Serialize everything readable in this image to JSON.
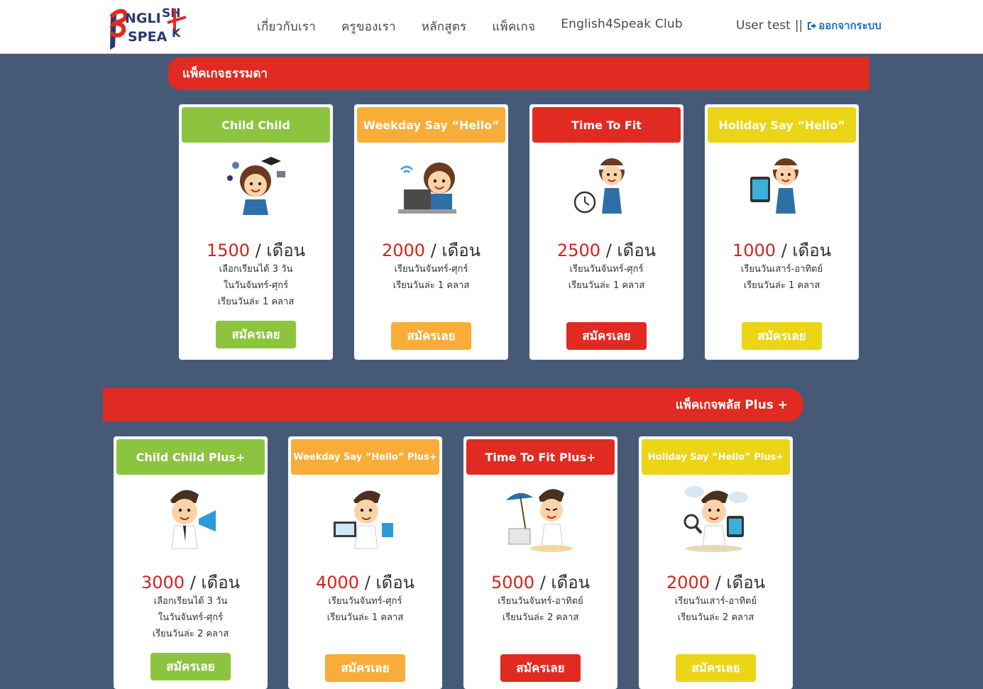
{
  "header": {
    "logo_text": "ENGLISH SPEAK",
    "nav": [
      "เกี่ยวกับเรา",
      "ครูของเรา",
      "หลักสูตร",
      "แพ็คเกจ",
      "English4Speak Club"
    ],
    "user_label": "User test",
    "separator": "||",
    "logout_label": "ออกจากระบบ"
  },
  "colors": {
    "green": "#8cc43f",
    "orange": "#f8ad39",
    "red": "#e02a22",
    "yellow": "#ecd416",
    "background": "#465a78"
  },
  "section_normal": {
    "title": "แพ็คเกจธรรมดา",
    "cards": [
      {
        "title": "Child Child",
        "price": "1500",
        "unit": "/ เดือน",
        "lines": [
          "เลือกเรียนได้ 3 วัน",
          "ในวันจันทร์-ศุกร์",
          "เรียนวันล่ะ 1 คลาส"
        ],
        "button": "สมัครเลย",
        "color": "green",
        "icon": "teacher-graduation-icon"
      },
      {
        "title": "Weekday Say “Hello”",
        "price": "2000",
        "unit": "/ เดือน",
        "lines": [
          "เรียนวันจันทร์-ศุกร์",
          "เรียนวันล่ะ 1 คลาส"
        ],
        "button": "สมัครเลย",
        "color": "orange",
        "icon": "teacher-laptop-icon"
      },
      {
        "title": "Time To Fit",
        "price": "2500",
        "unit": "/ เดือน",
        "lines": [
          "เรียนวันจันทร์-ศุกร์",
          "เรียนวันล่ะ 1 คลาส"
        ],
        "button": "สมัครเลย",
        "color": "red",
        "icon": "teacher-clock-icon"
      },
      {
        "title": "Holiday Say “Hello”",
        "price": "1000",
        "unit": "/ เดือน",
        "lines": [
          "เรียนวันเสาร์-อาทิตย์",
          "เรียนวันล่ะ 1 คลาส"
        ],
        "button": "สมัครเลย",
        "color": "yellow",
        "icon": "teacher-tablet-icon"
      }
    ]
  },
  "section_plus": {
    "title": "แพ็คเกจพลัส Plus +",
    "cards": [
      {
        "title": "Child Child Plus+",
        "price": "3000",
        "unit": "/ เดือน",
        "lines": [
          "เลือกเรียนได้ 3 วัน",
          "ในวันจันทร์-ศุกร์",
          "เรียนวันล่ะ 2 คลาส"
        ],
        "button": "สมัครเลย",
        "color": "green",
        "icon": "man-megaphone-icon"
      },
      {
        "title": "Weekday Say “Hello” Plus+",
        "price": "4000",
        "unit": "/ เดือน",
        "lines": [
          "เรียนวันจันทร์-ศุกร์",
          "เรียนวันล่ะ 1 คลาส"
        ],
        "button": "สมัครเลย",
        "color": "orange",
        "icon": "man-laptop-icon"
      },
      {
        "title": "Time To Fit Plus+",
        "price": "5000",
        "unit": "/ เดือน",
        "lines": [
          "เรียนวันจันทร์-อาทิตย์",
          "เรียนวันล่ะ 2 คลาส"
        ],
        "button": "สมัครเลย",
        "color": "red",
        "icon": "man-beach-icon"
      },
      {
        "title": "Holiday Say “Hello” Plus+",
        "price": "2000",
        "unit": "/ เดือน",
        "lines": [
          "เรียนวันเสาร์-อาทิตย์",
          "เรียนวันล่ะ 2 คลาส"
        ],
        "button": "สมัครเลย",
        "color": "yellow",
        "icon": "man-magnifier-icon"
      }
    ]
  }
}
